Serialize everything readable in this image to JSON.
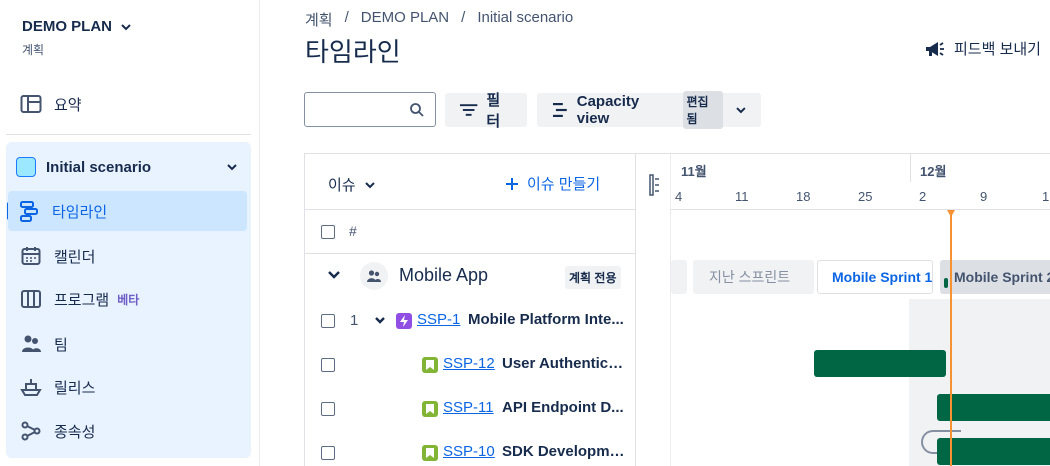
{
  "plan": {
    "title": "DEMO PLAN",
    "subtitle": "계획"
  },
  "sidebar": {
    "summary_label": "요약",
    "scenario": "Initial scenario",
    "items": [
      {
        "label": "타임라인",
        "icon": "timeline-icon",
        "active": true
      },
      {
        "label": "캘린더",
        "icon": "calendar-icon"
      },
      {
        "label": "프로그램",
        "icon": "program-icon",
        "badge": "베타"
      },
      {
        "label": "팀",
        "icon": "team-icon"
      },
      {
        "label": "릴리스",
        "icon": "release-icon"
      },
      {
        "label": "종속성",
        "icon": "dependency-icon"
      }
    ]
  },
  "breadcrumb": [
    "계획",
    "/",
    "DEMO PLAN",
    "/",
    "Initial scenario"
  ],
  "page": {
    "title": "타임라인",
    "feedback": "피드백 보내기"
  },
  "toolbar": {
    "search_placeholder": "",
    "filter_label": "필터",
    "view_label": "Capacity view",
    "view_badge": "편집됨"
  },
  "table": {
    "issue_header": "이슈",
    "create_issue": "이슈 만들기",
    "hash_header": "#",
    "team": {
      "name": "Mobile App",
      "badge": "계획 전용"
    },
    "rows": [
      {
        "num": "1",
        "key": "SSP-1",
        "title": "Mobile Platform Inte...",
        "type": "epic"
      },
      {
        "num": "",
        "key": "SSP-12",
        "title": "User Authentica...",
        "type": "story"
      },
      {
        "num": "",
        "key": "SSP-11",
        "title": "API Endpoint D...",
        "type": "story"
      },
      {
        "num": "",
        "key": "SSP-10",
        "title": "SDK Developme...",
        "type": "story"
      }
    ]
  },
  "timeline": {
    "months": [
      "11월",
      "12월"
    ],
    "days": [
      "4",
      "11",
      "18",
      "25",
      "2",
      "9",
      "1"
    ],
    "sprints": {
      "past": "지난 스프린트",
      "active": "Mobile Sprint 1",
      "next": "Mobile Sprint 2"
    }
  },
  "colors": {
    "accent": "#0c66e4",
    "bar": "#006644",
    "today": "#f79232",
    "epic": "#904ee2",
    "story": "#82b536"
  }
}
